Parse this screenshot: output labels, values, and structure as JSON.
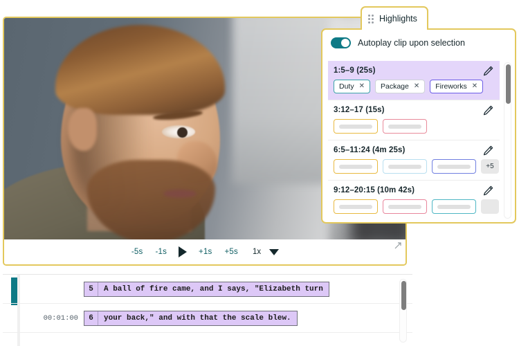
{
  "video": {
    "alt": "man-in-profile-video-frame"
  },
  "player": {
    "back5_label": "-5s",
    "back1_label": "-1s",
    "play_label": "play",
    "fwd1_label": "+1s",
    "fwd5_label": "+5s",
    "speed_label": "1x",
    "caret_label": "speed-menu",
    "expand_label": "expand"
  },
  "highlights": {
    "tab_label": "Highlights",
    "drag_handle": "drag-handle-icon",
    "autoplay": {
      "label": "Autoplay clip upon selection",
      "enabled": true,
      "accent": "#0f7a86"
    },
    "items": [
      {
        "range": "1:5–9 (25s)",
        "selected": true,
        "tags": [
          {
            "label": "Duty",
            "color": "#3aa3a8",
            "close": "✕"
          },
          {
            "label": "Package",
            "color": "#cfd4d8",
            "close": "✕"
          },
          {
            "label": "Fireworks",
            "color": "#6b5ce7",
            "close": "✕"
          }
        ],
        "skeletons": [],
        "more": null
      },
      {
        "range": "3:12–17  (15s)",
        "selected": false,
        "tags": [],
        "skeletons": [
          {
            "color": "#e8b93f"
          },
          {
            "color": "#e88a9a"
          }
        ],
        "more": null
      },
      {
        "range": "6:5–11:24  (4m 25s)",
        "selected": false,
        "tags": [],
        "skeletons": [
          {
            "color": "#e8b93f"
          },
          {
            "color": "#b8dff0"
          },
          {
            "color": "#6f7ee0"
          }
        ],
        "more": "+5"
      },
      {
        "range": "9:12–20:15 (10m 42s)",
        "selected": false,
        "tags": [],
        "skeletons": [
          {
            "color": "#e8b93f"
          },
          {
            "color": "#e8869c"
          },
          {
            "color": "#4db6c4"
          }
        ],
        "more": " "
      }
    ]
  },
  "transcript": {
    "rows": [
      {
        "time": "",
        "number": "5",
        "text": "A ball of fire came, and I says, \"Elizabeth turn"
      },
      {
        "time": "00:01:00",
        "number": "6",
        "text": "your back,\" and with that the scale blew."
      }
    ]
  },
  "colors": {
    "panel_border": "#e3c85c",
    "selection": "#e4d6fa",
    "teal": "#0f7a86"
  }
}
